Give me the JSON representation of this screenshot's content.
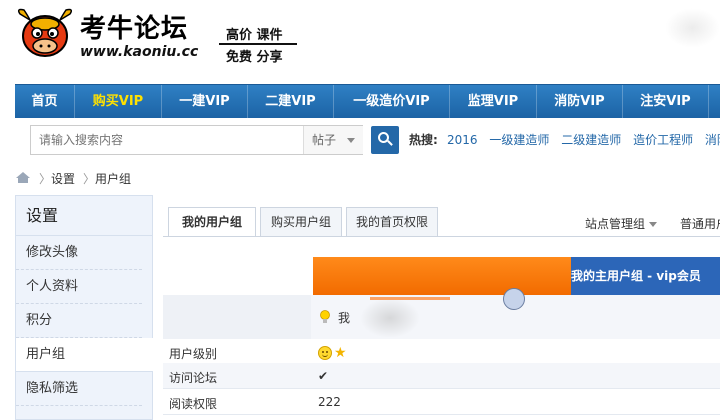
{
  "logo": {
    "title": "考牛论坛",
    "url": "www.kaoniu.cc",
    "tag_line1": "高价 课件",
    "tag_line2": "免费 分享"
  },
  "nav": {
    "items": [
      {
        "label": "首页",
        "active": false
      },
      {
        "label": "购买VIP",
        "active": true
      },
      {
        "label": "一建VIP",
        "active": false
      },
      {
        "label": "二建VIP",
        "active": false
      },
      {
        "label": "一级造价VIP",
        "active": false
      },
      {
        "label": "监理VIP",
        "active": false
      },
      {
        "label": "消防VIP",
        "active": false
      },
      {
        "label": "注安VIP",
        "active": false
      }
    ]
  },
  "search": {
    "placeholder": "请输入搜索内容",
    "type": "帖子",
    "hot_label": "热搜:",
    "hot_links": [
      "2016",
      "一级建造师",
      "二级建造师",
      "造价工程师",
      "消防工"
    ]
  },
  "breadcrumb": {
    "items": [
      "设置",
      "用户组"
    ]
  },
  "sidebar": {
    "title": "设置",
    "items": [
      {
        "label": "修改头像",
        "active": false
      },
      {
        "label": "个人资料",
        "active": false
      },
      {
        "label": "积分",
        "active": false
      },
      {
        "label": "用户组",
        "active": true
      },
      {
        "label": "隐私筛选",
        "active": false
      }
    ]
  },
  "tabs": {
    "items": [
      {
        "label": "我的用户组",
        "active": true
      },
      {
        "label": "购买用户组",
        "active": false
      },
      {
        "label": "我的首页权限",
        "active": false
      }
    ],
    "site_admin": "站点管理组",
    "normal_user": "普通用户"
  },
  "group": {
    "header": "我的主用户组 - vip会员",
    "main_row_text": "我",
    "rows": [
      {
        "label": "用户级别",
        "value": ""
      },
      {
        "label": "访问论坛",
        "value": "✔"
      },
      {
        "label": "阅读权限",
        "value": "222"
      }
    ]
  },
  "colors": {
    "nav_bg": "#1c63a5",
    "nav_active": "#ffe100",
    "orange_bar": "#f26b00",
    "group_header": "#2c66b8"
  }
}
